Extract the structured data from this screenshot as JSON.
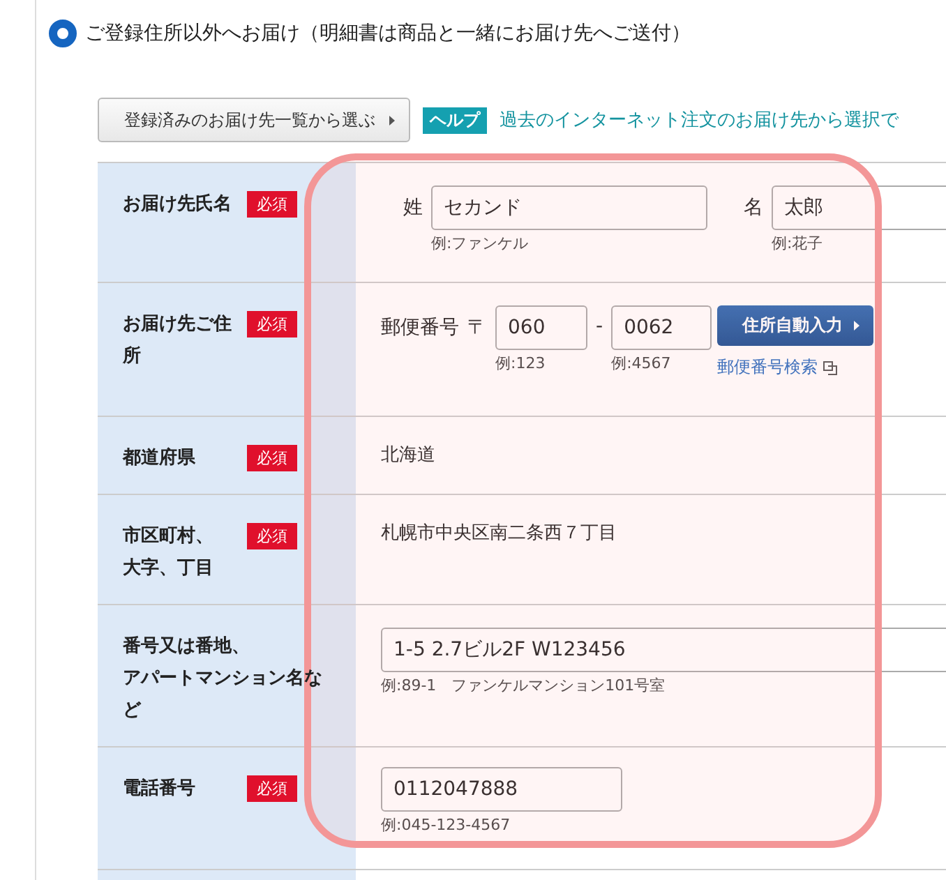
{
  "delivery_option": {
    "label": "ご登録住所以外へお届け（明細書は商品と一緒にお届け先へご送付）",
    "selected": true
  },
  "select_button": "登録済みのお届け先一覧から選ぶ",
  "help": {
    "badge": "ヘルプ",
    "text": "過去のインターネット注文のお届け先から選択で"
  },
  "form_rows": [
    {
      "kind": "name",
      "label": "お届け先氏名",
      "required": true,
      "badge": "必須",
      "fields": [
        {
          "label": "姓",
          "value": "セカンド",
          "hint": "例:ファンケル"
        },
        {
          "label": "名",
          "value": "太郎",
          "hint": "例:花子"
        }
      ]
    },
    {
      "kind": "postal",
      "label": "お届け先ご住所",
      "required": true,
      "badge": "必須",
      "prefix": "郵便番号",
      "symbol": "〒",
      "separator": "-",
      "fields": [
        {
          "value": "060",
          "hint": "例:123"
        },
        {
          "value": "0062",
          "hint": "例:4567"
        }
      ],
      "button": "住所自動入力",
      "link": "郵便番号検索"
    },
    {
      "kind": "static",
      "label": "都道府県",
      "required": true,
      "badge": "必須",
      "value": "北海道"
    },
    {
      "kind": "static",
      "label_lines": [
        "市区町村、",
        "大字、丁目"
      ],
      "required": true,
      "badge": "必須",
      "value": "札幌市中央区南二条西７丁目"
    },
    {
      "kind": "wide_input",
      "label_lines": [
        "番号又は番地、",
        "アパートマンション名など"
      ],
      "required": false,
      "value": "1-5 2.7ビル2F W123456",
      "hint": "例:89-1　ファンケルマンション101号室"
    },
    {
      "kind": "short_input",
      "label": "電話番号",
      "required": true,
      "badge": "必須",
      "value": "0112047888",
      "hint": "例:045-123-4567"
    }
  ]
}
